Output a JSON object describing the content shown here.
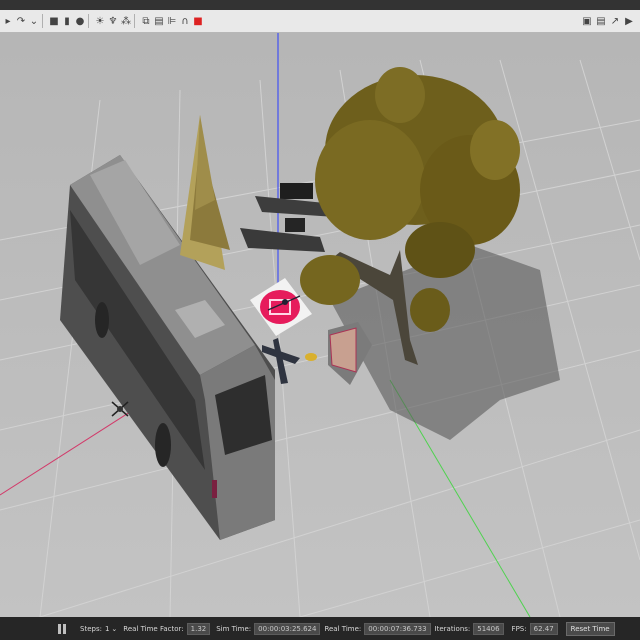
{
  "toolbar": {
    "left_icons": [
      "arrow-icon",
      "redo-icon",
      "chevron-icon",
      "box-icon",
      "cylinder-icon",
      "sphere-icon",
      "sun-icon",
      "spotlight-icon",
      "directional-light-icon",
      "copy-icon",
      "paste-icon",
      "align-icon",
      "magnet-icon",
      "record-icon"
    ],
    "right_icons": [
      "screenshot-icon",
      "log-icon",
      "plot-icon",
      "video-icon"
    ]
  },
  "status": {
    "steps_label": "Steps:",
    "steps_value": "1",
    "rtf_label": "Real Time Factor:",
    "rtf_value": "1.32",
    "sim_time_label": "Sim Time:",
    "sim_time_value": "00:00:03:25.624",
    "real_time_label": "Real Time:",
    "real_time_value": "00:00:07:36.733",
    "iterations_label": "Iterations:",
    "iterations_value": "51406",
    "fps_label": "FPS:",
    "fps_value": "62.47",
    "reset_label": "Reset Time"
  }
}
